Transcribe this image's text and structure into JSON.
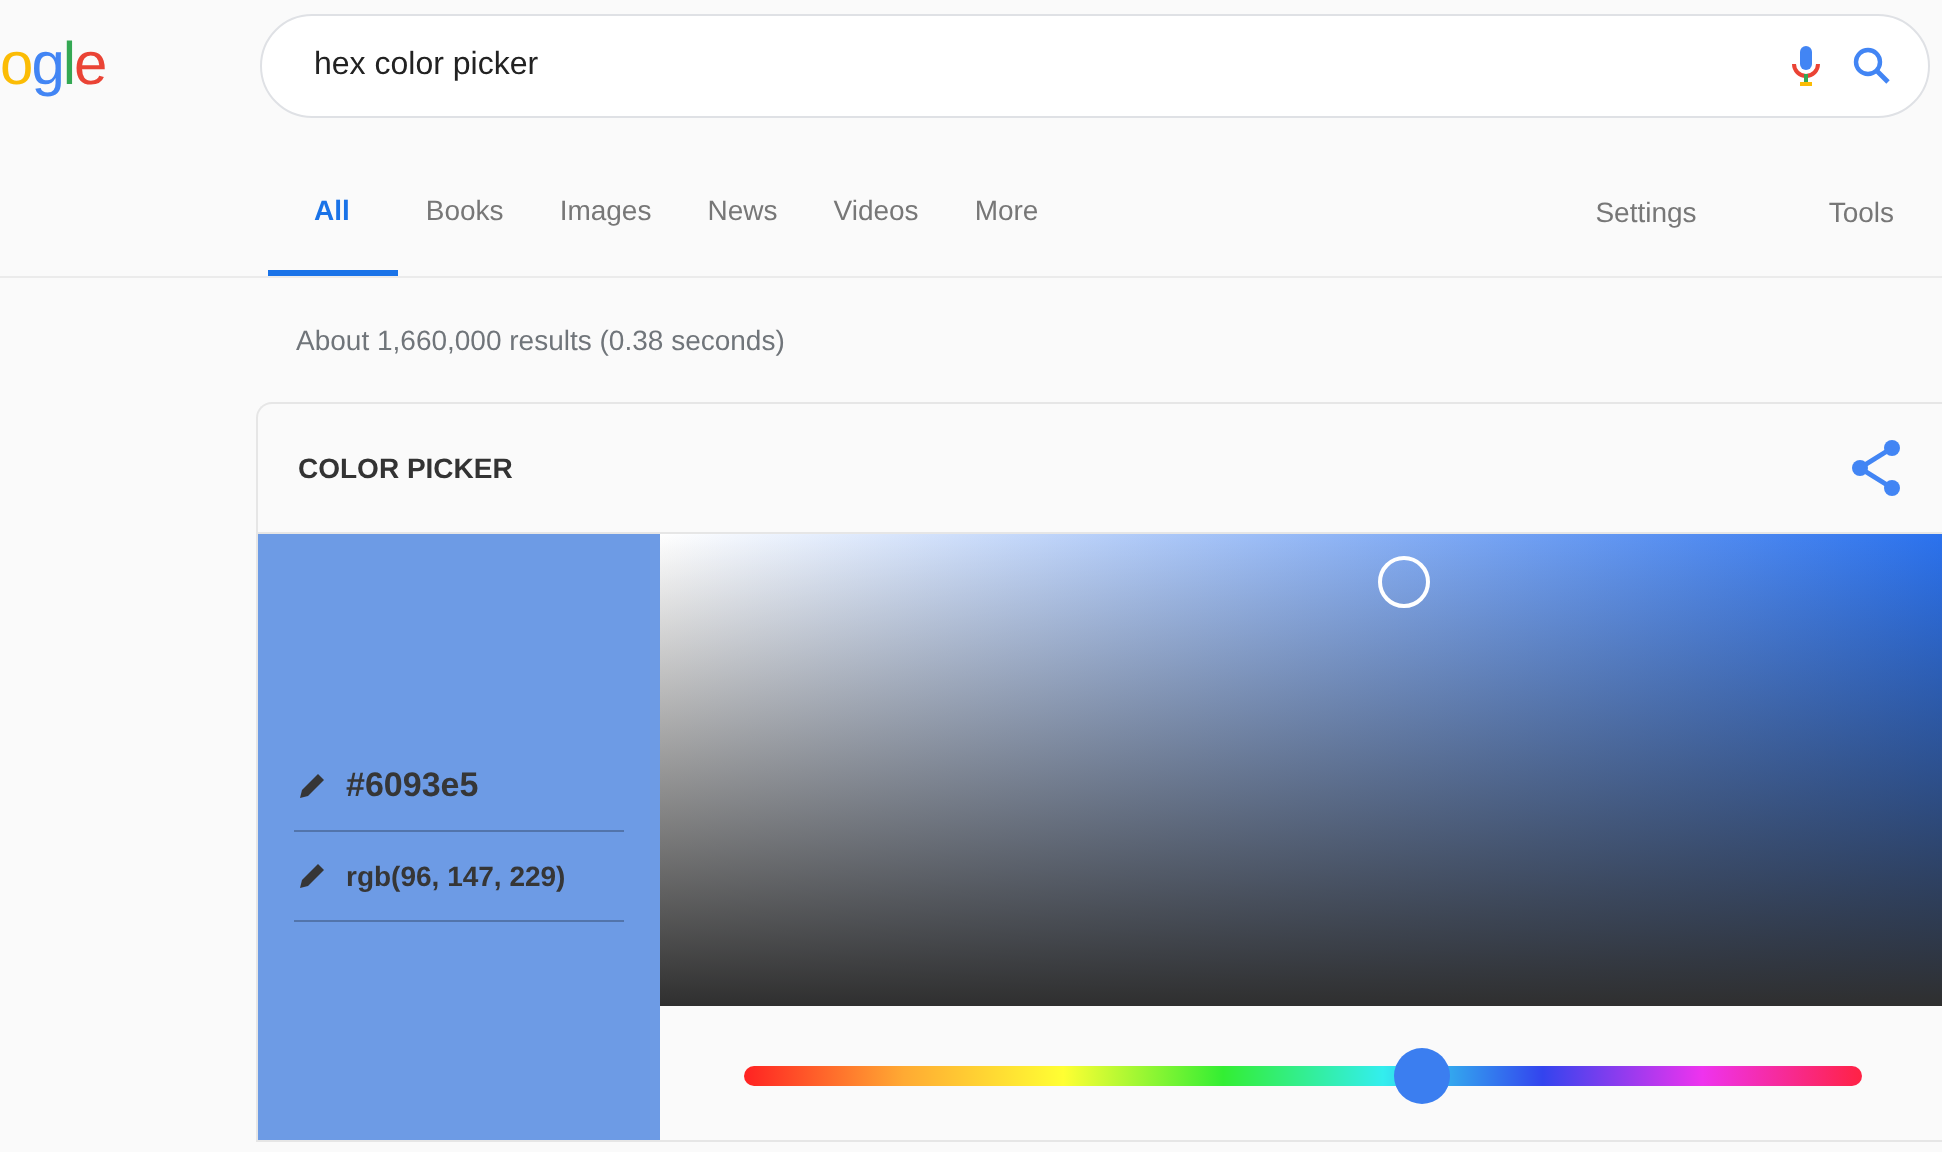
{
  "logo": "ogle",
  "search": {
    "value": "hex color picker"
  },
  "tabs": [
    {
      "label": "All",
      "selected": true
    },
    {
      "label": "Books",
      "selected": false
    },
    {
      "label": "Images",
      "selected": false
    },
    {
      "label": "News",
      "selected": false
    },
    {
      "label": "Videos",
      "selected": false
    },
    {
      "label": "More",
      "selected": false
    }
  ],
  "tools": [
    "Settings",
    "Tools"
  ],
  "result_stats": "About 1,660,000 results (0.38 seconds)",
  "card": {
    "title": "COLOR PICKER",
    "hex": "#6093e5",
    "rgb": "rgb(96, 147, 229)",
    "hue": {
      "level": 0.606
    }
  }
}
